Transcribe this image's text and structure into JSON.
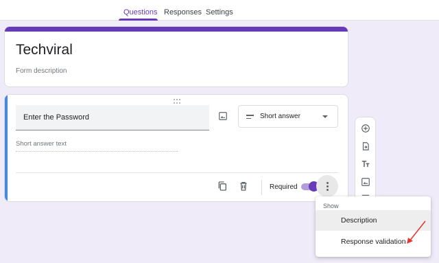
{
  "tabs": [
    {
      "label": "Questions",
      "active": true
    },
    {
      "label": "Responses",
      "active": false
    },
    {
      "label": "Settings",
      "active": false
    }
  ],
  "form": {
    "title": "Techviral",
    "description_placeholder": "Form description"
  },
  "question": {
    "title": "Enter the Password",
    "type": "Short answer",
    "answer_placeholder": "Short answer text",
    "required_label": "Required",
    "required": true
  },
  "toolbar": {
    "icons": [
      "add-question-icon",
      "import-questions-icon",
      "add-title-icon",
      "add-image-icon",
      "add-section-icon"
    ]
  },
  "menu": {
    "header": "Show",
    "items": [
      {
        "label": "Description",
        "highlighted": true
      },
      {
        "label": "Response validation",
        "highlighted": false
      }
    ]
  },
  "colors": {
    "accent": "#673ab7",
    "question_focus_bar": "#4285f4",
    "background": "#f0ebf8",
    "annotation_arrow": "#e53935"
  }
}
